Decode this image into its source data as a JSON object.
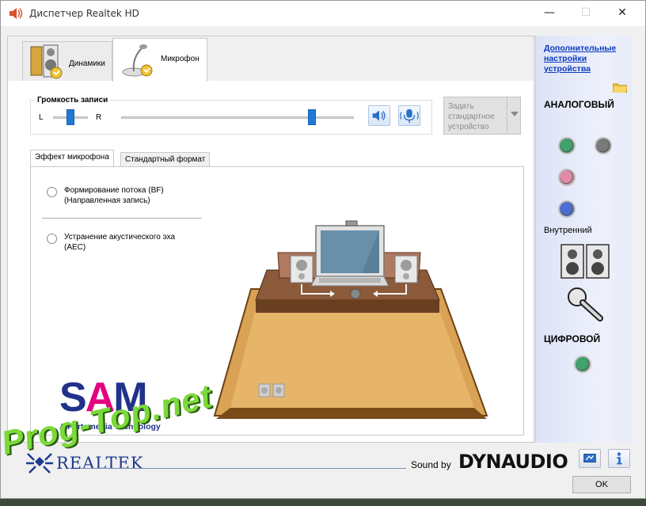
{
  "window": {
    "title": "Диспетчер Realtek HD",
    "minimize_glyph": "—",
    "maximize_glyph": "☐",
    "close_glyph": "✕"
  },
  "device_tabs": [
    {
      "label": "Динамики",
      "icon": "speakers-icon",
      "selected": false
    },
    {
      "label": "Микрофон",
      "icon": "microphone-icon",
      "selected": true
    }
  ],
  "recording_volume": {
    "title": "Громкость записи",
    "left_label": "L",
    "right_label": "R",
    "balance_level": 0.5,
    "volume_level": 0.82
  },
  "set_default_button": {
    "label": "Задать стандартное устройство",
    "enabled": false
  },
  "effect_tabs": [
    "Эффект микрофона",
    "Стандартный формат"
  ],
  "effects": [
    {
      "label_line1": "Формирование потока (BF)",
      "label_line2": "(Направленная запись)",
      "checked": false
    },
    {
      "label_line1": "Устранение акустического эха",
      "label_line2": "(AEC)",
      "checked": false
    }
  ],
  "sam_logo": {
    "text_s": "S",
    "text_a": "A",
    "text_m": "M",
    "subtitle": "A Fortemedia Technology"
  },
  "side_panel": {
    "advanced_link": "Дополнительные настройки устройства",
    "analog_title": "АНАЛОГОВЫЙ",
    "inner_label": "Внутренний",
    "digital_title": "ЦИФРОВОЙ",
    "jack_colors": [
      "#3fa36b",
      "#7a7a7a",
      "#e08aa8",
      "#4a6fd0",
      "#3fa36b"
    ]
  },
  "footer": {
    "brand": "REALTEK",
    "sound_by": "Sound by",
    "dynaudio": "DYNAUDIO",
    "ok_label": "OK"
  },
  "watermark": "Prog-Top.net"
}
